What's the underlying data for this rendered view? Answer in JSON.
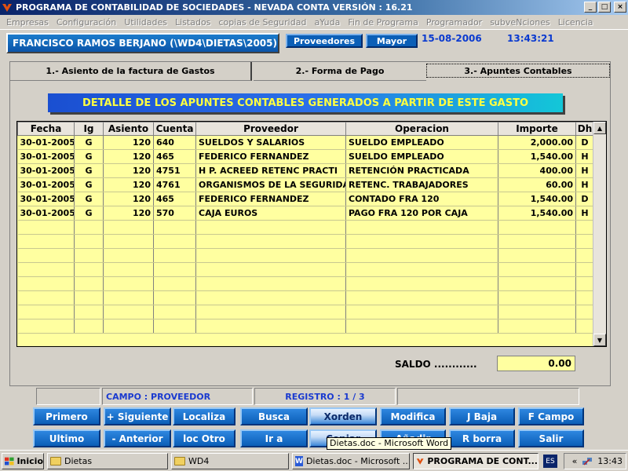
{
  "window": {
    "title": "PROGRAMA DE CONTABILIDAD DE SOCIEDADES - NEVADA CONTA  VERSIÓN : 16.21",
    "btn_min": "_",
    "btn_max": "□",
    "btn_close": "×"
  },
  "menu": [
    "Empresas",
    "Configuración",
    "Utilidades",
    "Listados",
    "copias de Seguridad",
    "aYuda",
    "Fin de Programa",
    "Programador",
    "subveNciones",
    "Licencia"
  ],
  "header": {
    "user_path": "FRANCISCO RAMOS BERJANO  (\\WD4\\DIETAS\\2005)",
    "btn_proveedores": "Proveedores",
    "btn_mayor": "Mayor",
    "date": "15-08-2006",
    "time": "13:43:21"
  },
  "tabs": [
    "1.-  Asiento de la factura de Gastos",
    "2.-  Forma de Pago",
    "3.-  Apuntes Contables"
  ],
  "banner": "DETALLE DE LOS APUNTES CONTABLES GENERADOS A PARTIR DE ESTE GASTO",
  "table": {
    "columns": [
      "Fecha",
      "Ig",
      "Asiento",
      "Cuenta",
      "Proveedor",
      "Operacion",
      "Importe",
      "Dh"
    ],
    "rows": [
      [
        "30-01-2005",
        "G",
        "120",
        "640",
        "SUELDOS Y SALARIOS",
        "SUELDO EMPLEADO",
        "2,000.00",
        "D"
      ],
      [
        "30-01-2005",
        "G",
        "120",
        "465",
        "FEDERICO FERNANDEZ",
        "SUELDO EMPLEADO",
        "1,540.00",
        "H"
      ],
      [
        "30-01-2005",
        "G",
        "120",
        "4751",
        "H P. ACREED RETENC PRACTI",
        "RETENCIÓN PRACTICADA",
        "400.00",
        "H"
      ],
      [
        "30-01-2005",
        "G",
        "120",
        "4761",
        "ORGANISMOS DE LA SEGURIDA",
        "RETENC. TRABAJADORES",
        "60.00",
        "H"
      ],
      [
        "30-01-2005",
        "G",
        "120",
        "465",
        "FEDERICO FERNANDEZ",
        "CONTADO  FRA   120",
        "1,540.00",
        "D"
      ],
      [
        "30-01-2005",
        "G",
        "120",
        "570",
        "CAJA EUROS",
        "PAGO FRA  120 POR CAJA",
        "1,540.00",
        "H"
      ]
    ]
  },
  "saldo": {
    "label": "SALDO ............",
    "value": "0.00"
  },
  "status": {
    "campo": "CAMPO : PROVEEDOR",
    "registro": "REGISTRO :     1 / 3"
  },
  "buttons_row1": [
    "Primero",
    "+ Siguiente",
    "Localiza",
    "Busca",
    "Xorden",
    "Modifica",
    "J  Baja",
    "F Campo"
  ],
  "buttons_row2": [
    "Ultimo",
    "- Anterior",
    "loc Otro",
    "Ir   a",
    "Copiar",
    "Añadir",
    "R borra",
    "Salir"
  ],
  "tooltip": "Dietas.doc - Microsoft Word",
  "taskbar": {
    "start": "Inicio",
    "tasks": [
      "Dietas",
      "WD4",
      "Dietas.doc - Microsoft ...",
      "PROGRAMA DE CONT..."
    ],
    "lang": "ES",
    "clock": "13:43"
  }
}
